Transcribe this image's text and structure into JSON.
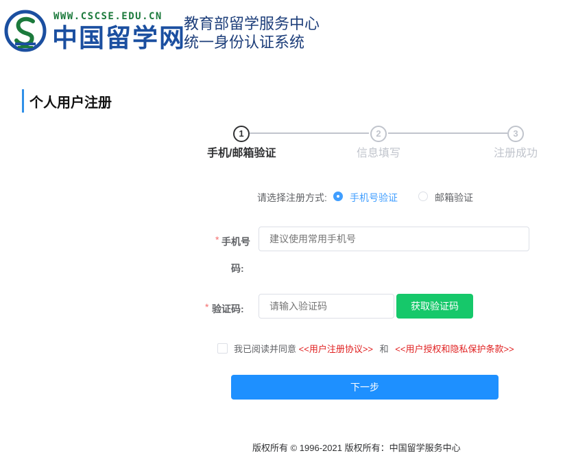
{
  "header": {
    "logo_url": "WWW.CSCSE.EDU.CN",
    "logo_name": "中国留学网",
    "system_line1": "教育部留学服务中心",
    "system_line2": "统一身份认证系统"
  },
  "page_title": "个人用户注册",
  "steps": [
    {
      "number": "1",
      "label": "手机/邮箱验证",
      "status": "active"
    },
    {
      "number": "2",
      "label": "信息填写",
      "status": "pending"
    },
    {
      "number": "3",
      "label": "注册成功",
      "status": "pending"
    }
  ],
  "register_method": {
    "prompt": "请选择注册方式:",
    "options": [
      {
        "label": "手机号验证",
        "checked": true
      },
      {
        "label": "邮箱验证",
        "checked": false
      }
    ]
  },
  "form": {
    "required_mark": "*",
    "phone": {
      "label_line1": "手机号",
      "label_line2": "码:",
      "value": "",
      "placeholder": "建议使用常用手机号"
    },
    "code": {
      "label": "验证码:",
      "value": "",
      "placeholder": "请输入验证码",
      "button": "获取验证码"
    }
  },
  "agreement": {
    "checked": false,
    "text": "我已阅读并同意",
    "link1": "<<用户注册协议>>",
    "connector": "和",
    "link2": "<<用户授权和隐私保护条款>>"
  },
  "next_button": "下一步",
  "footer": "版权所有 © 1996-2021 版权所有：中国留学服务中心",
  "colors": {
    "primary": "#1e90ff",
    "accent_blue": "#409eff",
    "green_button": "#16c86a",
    "link_red": "#e02020",
    "brand_blue": "#1b4fa0",
    "brand_green": "#1c7a3c"
  }
}
